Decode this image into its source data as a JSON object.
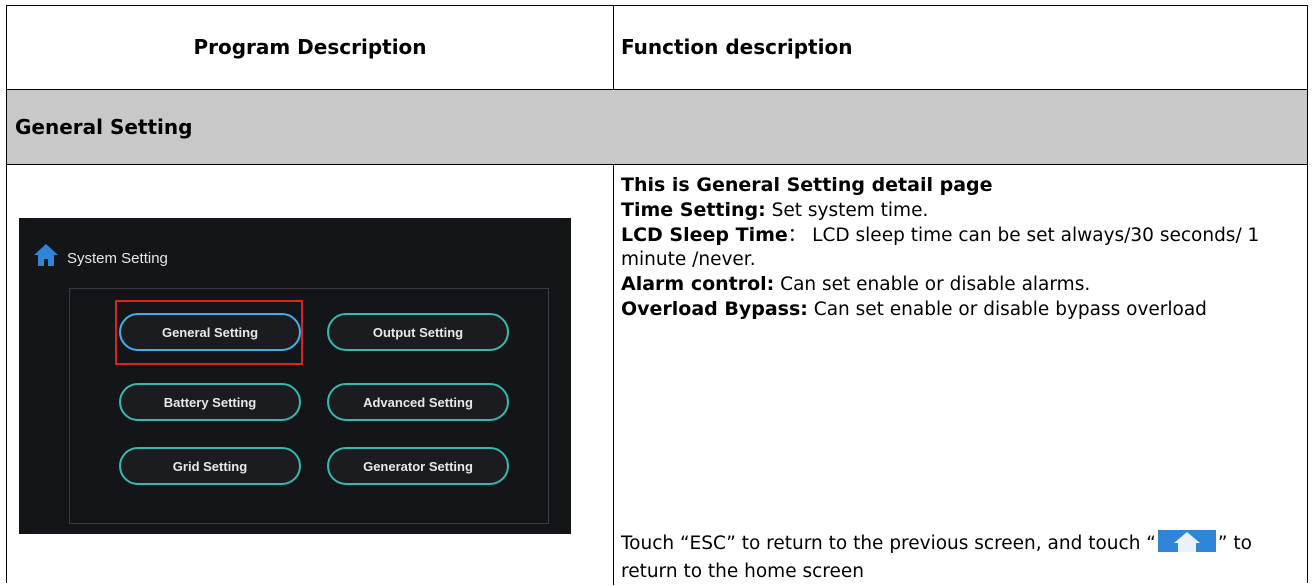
{
  "table": {
    "headers": {
      "program": "Program Description",
      "function": "Function description"
    },
    "section": "General Setting"
  },
  "screenshot": {
    "title": "System Setting",
    "buttons": [
      {
        "label": "General Setting",
        "selected": true
      },
      {
        "label": "Output Setting"
      },
      {
        "label": "Battery Setting"
      },
      {
        "label": "Advanced Setting"
      },
      {
        "label": "Grid Setting"
      },
      {
        "label": "Generator Setting"
      }
    ],
    "highlight_color": "#d8241c",
    "button_border_color": "#38b8b0"
  },
  "description": {
    "heading": "This is General Setting detail page",
    "items": [
      {
        "label": "Time Setting:",
        "text": " Set system time."
      },
      {
        "label": "LCD Sleep Time",
        "sep": "：",
        "text": " LCD sleep time can be set always/30 seconds/ 1 minute /never."
      },
      {
        "label": "Alarm control:",
        "text": " Can set enable or disable alarms."
      },
      {
        "label": "Overload Bypass:",
        "text": " Can set enable or disable bypass overload"
      }
    ],
    "footer_before": "Touch “ESC” to return to the previous screen, and touch “",
    "footer_after": "” to return to the home screen",
    "home_icon_color": "#2f86d8"
  }
}
